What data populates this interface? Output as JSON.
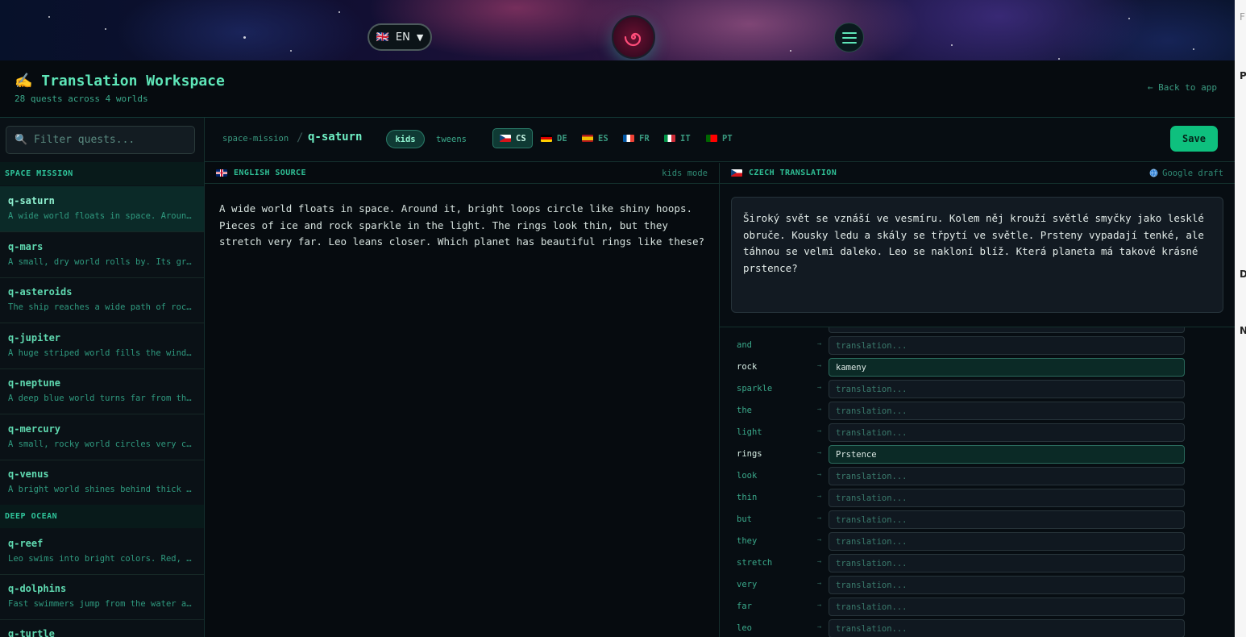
{
  "banner": {
    "language": {
      "flag": "🇬🇧",
      "code": "EN",
      "chevron": "▼"
    },
    "menu_icon": "hamburger-icon",
    "logo_icon": "spiral-galaxy-icon"
  },
  "header": {
    "title": "✍️ Translation Workspace",
    "subtitle": "28 quests across 4 worlds",
    "back": "← Back to app"
  },
  "scroll_strip_glyphs": [
    "F",
    "P",
    "D",
    "N"
  ],
  "sidebar": {
    "filter_placeholder": "🔍 Filter quests...",
    "groups": [
      {
        "title": "SPACE MISSION",
        "quests": [
          {
            "id": "q-saturn",
            "desc": "A wide world floats in space. Around it, bright loops circle like shiny hoops.",
            "active": true
          },
          {
            "id": "q-mars",
            "desc": "A small, dry world rolls by. Its ground is red and dusty."
          },
          {
            "id": "q-asteroids",
            "desc": "The ship reaches a wide path of rocks floating in space."
          },
          {
            "id": "q-jupiter",
            "desc": "A huge striped world fills the window with its swirling clouds."
          },
          {
            "id": "q-neptune",
            "desc": "A deep blue world turns far from the sun."
          },
          {
            "id": "q-mercury",
            "desc": "A small, rocky world circles very close to the sun."
          },
          {
            "id": "q-venus",
            "desc": "A bright world shines behind thick yellow clouds."
          }
        ]
      },
      {
        "title": "DEEP OCEAN",
        "quests": [
          {
            "id": "q-reef",
            "desc": "Leo swims into bright colors. Red, yellow and purple corals grow all around."
          },
          {
            "id": "q-dolphins",
            "desc": "Fast swimmers jump from the water and splash back down."
          },
          {
            "id": "q-turtle",
            "desc": ""
          }
        ]
      }
    ]
  },
  "toolbar": {
    "breadcrumb_parent": "space-mission",
    "breadcrumb_sep": "/",
    "breadcrumb_current": "q-saturn",
    "modes": [
      "kids",
      "tweens"
    ],
    "active_mode": "kids",
    "languages": [
      {
        "code": "CS",
        "active": true
      },
      {
        "code": "DE"
      },
      {
        "code": "ES"
      },
      {
        "code": "FR"
      },
      {
        "code": "IT"
      },
      {
        "code": "PT"
      }
    ],
    "save_label": "Save"
  },
  "source": {
    "label": "ENGLISH SOURCE",
    "mode_label": "kids mode",
    "text": "A wide world floats in space.  Around it, bright loops circle like shiny hoops.  Pieces of ice and rock sparkle in the light.  The rings look thin, but they stretch very far.  Leo leans closer.  Which planet has beautiful rings like these?"
  },
  "translation": {
    "label": "CZECH TRANSLATION",
    "draft_label": "Google draft",
    "text": "Široký svět se vznáší ve vesmíru.  Kolem něj krouží světlé smyčky jako lesklé obruče.  Kousky ledu a skály se třpytí ve světle.  Prsteny vypadají tenké, ale táhnou se velmi daleko.  Leo se nakloní blíž.  Která planeta má takové krásné prstence?",
    "glossary_placeholder": "translation...",
    "glossary_arrow": "→",
    "glossary": [
      {
        "word": "and",
        "value": ""
      },
      {
        "word": "rock",
        "value": "kameny"
      },
      {
        "word": "sparkle",
        "value": ""
      },
      {
        "word": "the",
        "value": ""
      },
      {
        "word": "light",
        "value": ""
      },
      {
        "word": "rings",
        "value": "Prstence"
      },
      {
        "word": "look",
        "value": ""
      },
      {
        "word": "thin",
        "value": ""
      },
      {
        "word": "but",
        "value": ""
      },
      {
        "word": "they",
        "value": ""
      },
      {
        "word": "stretch",
        "value": ""
      },
      {
        "word": "very",
        "value": ""
      },
      {
        "word": "far",
        "value": ""
      },
      {
        "word": "leo",
        "value": ""
      }
    ]
  },
  "colors": {
    "accent": "#5ee6b8",
    "save": "#0ec07e",
    "background": "#060c11"
  }
}
